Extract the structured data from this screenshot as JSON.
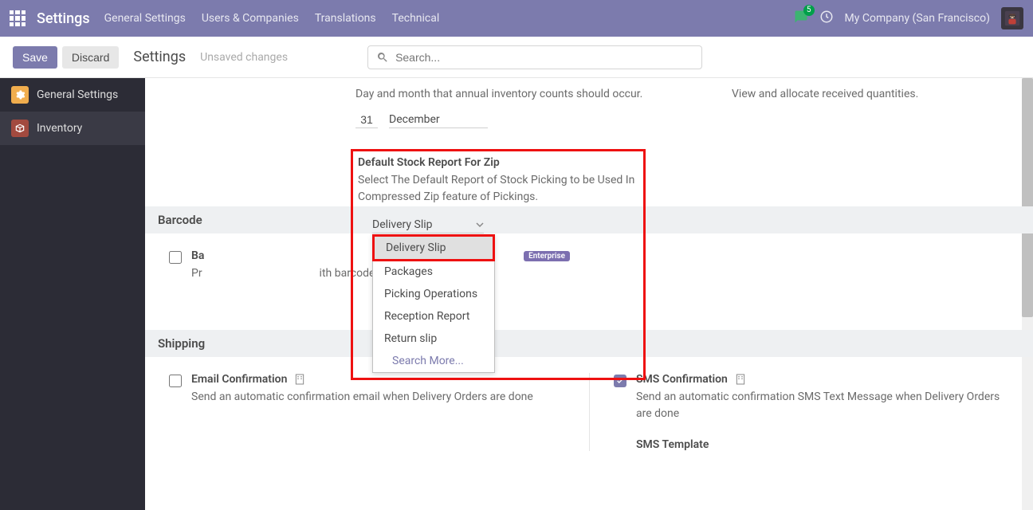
{
  "topbar": {
    "brand": "Settings",
    "menu": [
      "General Settings",
      "Users & Companies",
      "Translations",
      "Technical"
    ],
    "notif_count": "5",
    "company": "My Company (San Francisco)"
  },
  "actionbar": {
    "save": "Save",
    "discard": "Discard",
    "title": "Settings",
    "unsaved": "Unsaved changes",
    "search_placeholder": "Search..."
  },
  "sidebar": {
    "items": [
      {
        "label": "General Settings"
      },
      {
        "label": "Inventory"
      }
    ]
  },
  "top_section": {
    "desc": "Day and month that annual inventory counts should occur.",
    "right_desc": "View and allocate received quantities.",
    "day": "31",
    "month": "December"
  },
  "zip_report": {
    "title": "Default Stock Report For Zip",
    "desc": "Select The Default Report of Stock Picking to be Used In Compressed Zip feature of Pickings.",
    "selected": "Delivery Slip",
    "options": [
      "Delivery Slip",
      "Packages",
      "Picking Operations",
      "Reception Report",
      "Return slip"
    ],
    "search_more": "Search More..."
  },
  "barcode_section": {
    "header": "Barcode",
    "opt_title_prefix": "Ba",
    "opt_desc_prefix": "Pr",
    "opt_desc_suffix": "ith barcodes",
    "enterprise": "Enterprise"
  },
  "shipping_section": {
    "header": "Shipping",
    "email": {
      "title": "Email Confirmation",
      "desc": "Send an automatic confirmation email when Delivery Orders are done"
    },
    "sms": {
      "title": "SMS Confirmation",
      "desc": "Send an automatic confirmation SMS Text Message when Delivery Orders are done",
      "template_label": "SMS Template"
    }
  }
}
